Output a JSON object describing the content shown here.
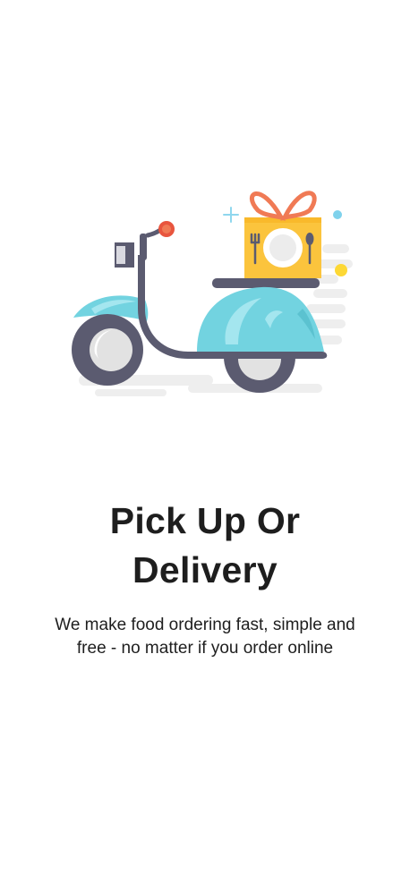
{
  "onboarding": {
    "illustration_icon": "delivery-scooter-icon",
    "title_line1": "Pick Up Or",
    "title_line2": "Delivery",
    "subtitle_line1": "We make food ordering fast, simple and",
    "subtitle_line2": "free - no matter if you order online"
  },
  "colors": {
    "background": "#ffffff",
    "text": "#1e1e1e",
    "scooter_body": "#72d3e0",
    "scooter_frame": "#5b5b70",
    "box": "#fbc43d",
    "ribbon": "#f07a55",
    "accent_yellow": "#fdd835",
    "accent_blue": "#7fd2ec"
  }
}
